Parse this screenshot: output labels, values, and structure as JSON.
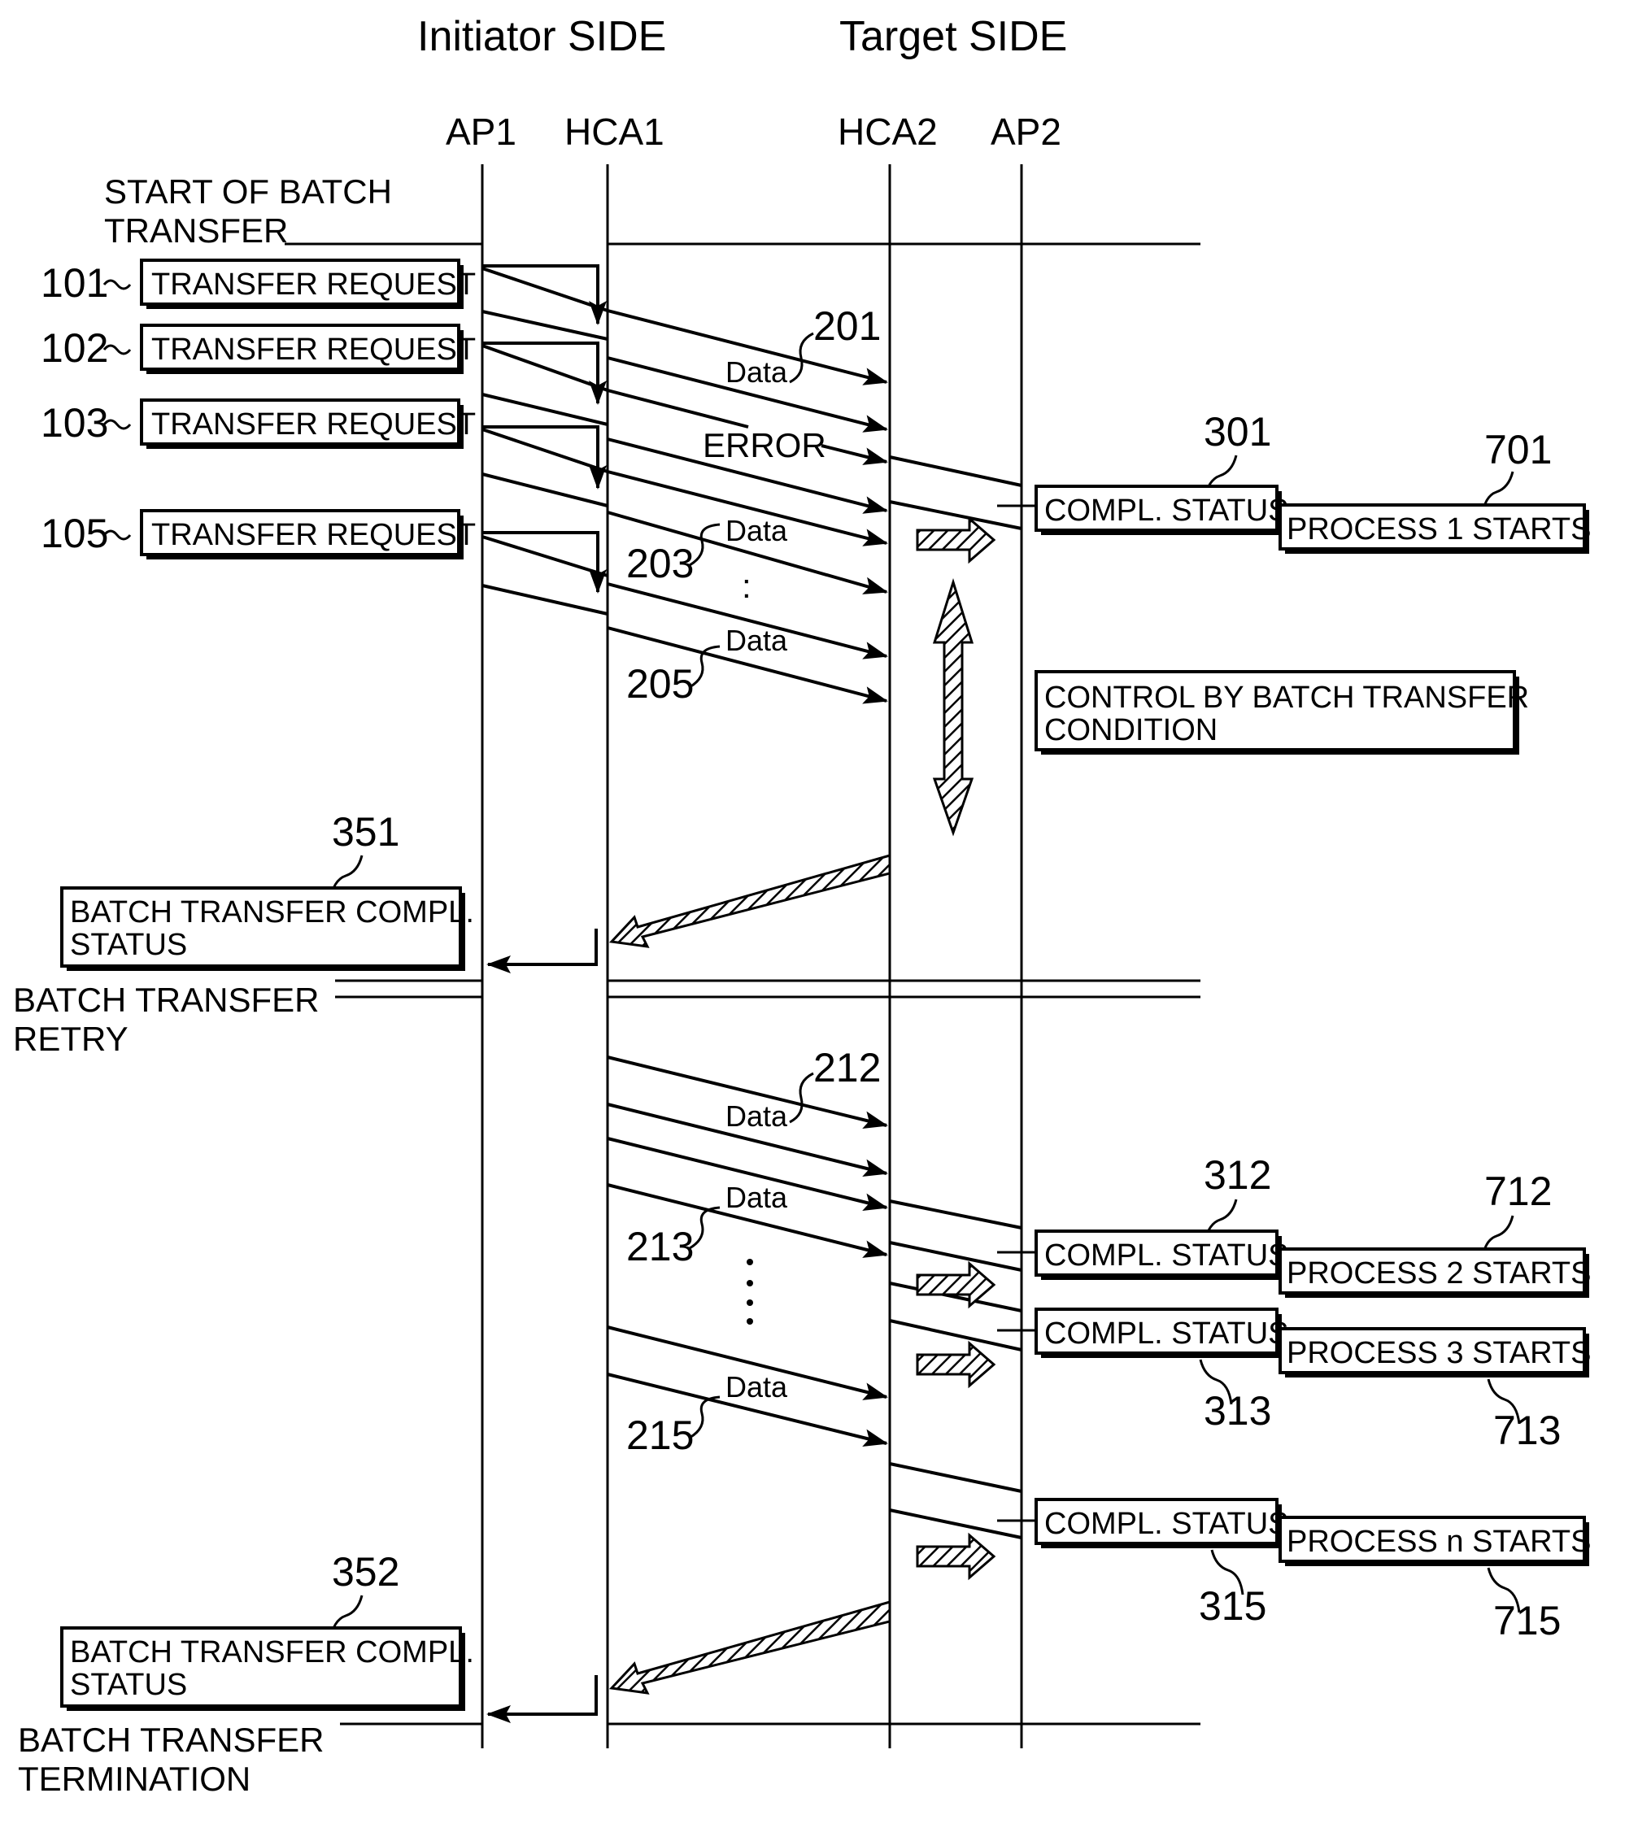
{
  "headers": {
    "initiator": "Initiator SIDE",
    "target": "Target SIDE"
  },
  "lanes": [
    "AP1",
    "HCA1",
    "HCA2",
    "AP2"
  ],
  "phases": {
    "start": [
      "START OF BATCH",
      "TRANSFER"
    ],
    "retry": [
      "BATCH TRANSFER",
      "RETRY"
    ],
    "termination": [
      "BATCH TRANSFER",
      "TERMINATION"
    ]
  },
  "requests": [
    {
      "ref": "101",
      "label": "TRANSFER REQUEST"
    },
    {
      "ref": "102",
      "label": "TRANSFER REQUEST"
    },
    {
      "ref": "103",
      "label": "TRANSFER REQUEST"
    },
    {
      "ref": "105",
      "label": "TRANSFER REQUEST"
    }
  ],
  "messages": {
    "data": "Data",
    "error": "ERROR",
    "ellipsis": ":"
  },
  "refs": {
    "r201": "201",
    "r203": "203",
    "r205": "205",
    "r212": "212",
    "r213": "213",
    "r215": "215",
    "r301": "301",
    "r312": "312",
    "r313": "313",
    "r315": "315",
    "r351": "351",
    "r352": "352",
    "r701": "701",
    "r712": "712",
    "r713": "713",
    "r715": "715"
  },
  "status": {
    "compl_status": "COMPL. STATUS",
    "process1": "PROCESS 1 STARTS",
    "process2": "PROCESS 2 STARTS",
    "process3": "PROCESS 3 STARTS",
    "processn": "PROCESS n STARTS",
    "control": [
      "CONTROL BY BATCH TRANSFER",
      "CONDITION"
    ],
    "batch_compl": [
      "BATCH TRANSFER COMPL.",
      "STATUS"
    ]
  }
}
